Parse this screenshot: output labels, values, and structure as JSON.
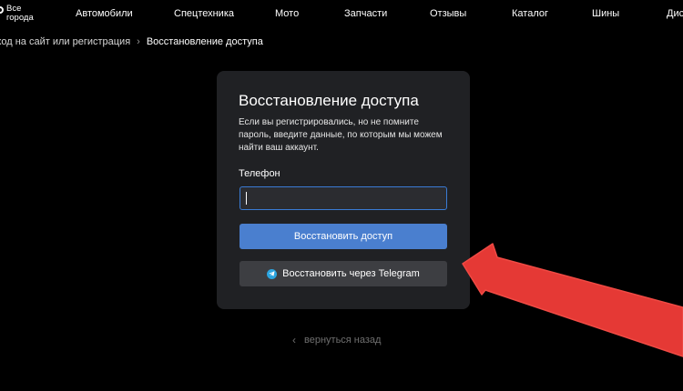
{
  "header": {
    "city_label": "Все города",
    "nav": [
      {
        "label": "Автомобили"
      },
      {
        "label": "Спецтехника"
      },
      {
        "label": "Мото"
      },
      {
        "label": "Запчасти"
      },
      {
        "label": "Отзывы"
      },
      {
        "label": "Каталог"
      },
      {
        "label": "Шины"
      },
      {
        "label": "Диски"
      }
    ]
  },
  "breadcrumb": {
    "link": "ход на сайт или регистрация",
    "separator": "›",
    "current": "Восстановление доступа"
  },
  "card": {
    "title": "Восстановление доступа",
    "description": "Если вы регистрировались, но не помните пароль, введите данные, по которым мы можем найти ваш аккаунт.",
    "phone_label": "Телефон",
    "phone_value": "",
    "submit_label": "Восстановить доступ",
    "telegram_label": "Восстановить через Telegram",
    "telegram_icon": "telegram-icon"
  },
  "back_link": {
    "label": "вернуться назад",
    "icon": "chevron-left-icon"
  },
  "colors": {
    "background": "#000000",
    "card": "#202124",
    "primary": "#4a7fcf",
    "secondary_button": "#3d3e42",
    "annotation_arrow": "#e53935"
  }
}
